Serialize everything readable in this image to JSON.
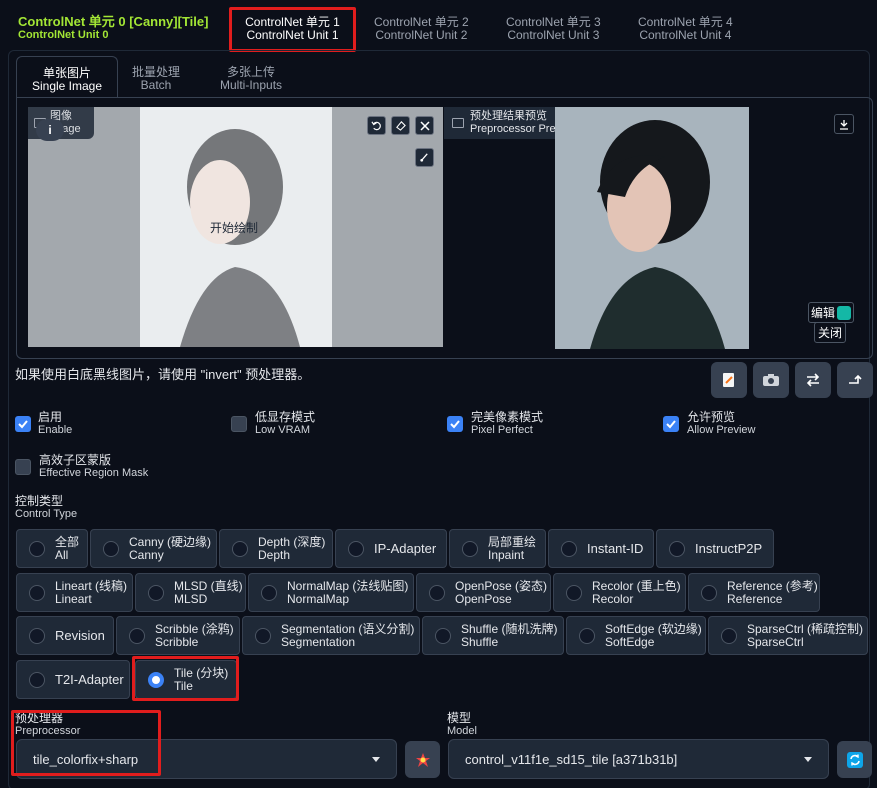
{
  "unit_tabs": [
    {
      "l1": "ControlNet 单元 0 [Canny][Tile]",
      "l2": "ControlNet Unit 0"
    },
    {
      "l1": "ControlNet 单元 1",
      "l2": "ControlNet Unit 1"
    },
    {
      "l1": "ControlNet 单元 2",
      "l2": "ControlNet Unit 2"
    },
    {
      "l1": "ControlNet 单元 3",
      "l2": "ControlNet Unit 3"
    },
    {
      "l1": "ControlNet 单元 4",
      "l2": "ControlNet Unit 4"
    }
  ],
  "input_tabs": [
    {
      "l1": "单张图片",
      "l2": "Single Image"
    },
    {
      "l1": "批量处理",
      "l2": "Batch"
    },
    {
      "l1": "多张上传",
      "l2": "Multi-Inputs"
    }
  ],
  "image_panel": {
    "l1": "图像",
    "l2": "Image",
    "overlay": "开始绘制"
  },
  "preview_panel": {
    "l1": "预处理结果预览",
    "l2": "Preprocessor Preview",
    "edit": "编辑",
    "close": "关闭"
  },
  "hint": "如果使用白底黑线图片，请使用 \"invert\" 预处理器。",
  "options": [
    {
      "l1": "启用",
      "l2": "Enable",
      "checked": true
    },
    {
      "l1": "低显存模式",
      "l2": "Low VRAM",
      "checked": false
    },
    {
      "l1": "完美像素模式",
      "l2": "Pixel Perfect",
      "checked": true
    },
    {
      "l1": "允许预览",
      "l2": "Allow Preview",
      "checked": true
    },
    {
      "l1": "高效子区蒙版",
      "l2": "Effective Region Mask",
      "checked": false
    }
  ],
  "control_type": {
    "l1": "控制类型",
    "l2": "Control Type",
    "items": [
      {
        "l1": "全部",
        "l2": "All"
      },
      {
        "l1": "Canny (硬边缘)",
        "l2": "Canny"
      },
      {
        "l1": "Depth (深度)",
        "l2": "Depth"
      },
      {
        "l1": "IP-Adapter",
        "l2": ""
      },
      {
        "l1": "局部重绘",
        "l2": "Inpaint"
      },
      {
        "l1": "Instant-ID",
        "l2": ""
      },
      {
        "l1": "InstructP2P",
        "l2": ""
      },
      {
        "l1": "Lineart (线稿)",
        "l2": "Lineart"
      },
      {
        "l1": "MLSD (直线)",
        "l2": "MLSD"
      },
      {
        "l1": "NormalMap (法线贴图)",
        "l2": "NormalMap"
      },
      {
        "l1": "OpenPose (姿态)",
        "l2": "OpenPose"
      },
      {
        "l1": "Recolor (重上色)",
        "l2": "Recolor"
      },
      {
        "l1": "Reference (参考)",
        "l2": "Reference"
      },
      {
        "l1": "Revision",
        "l2": ""
      },
      {
        "l1": "Scribble (涂鸦)",
        "l2": "Scribble"
      },
      {
        "l1": "Segmentation (语义分割)",
        "l2": "Segmentation"
      },
      {
        "l1": "Shuffle (随机洗牌)",
        "l2": "Shuffle"
      },
      {
        "l1": "SoftEdge (软边缘)",
        "l2": "SoftEdge"
      },
      {
        "l1": "SparseCtrl (稀疏控制)",
        "l2": "SparseCtrl"
      },
      {
        "l1": "T2I-Adapter",
        "l2": ""
      },
      {
        "l1": "Tile (分块)",
        "l2": "Tile"
      }
    ],
    "selected": "Tile"
  },
  "preprocessor": {
    "l1": "预处理器",
    "l2": "Preprocessor",
    "value": "tile_colorfix+sharp"
  },
  "model": {
    "l1": "模型",
    "l2": "Model",
    "value": "control_v11f1e_sd15_tile [a371b31b]"
  },
  "colors": {
    "accent": "#3b82f6",
    "unit0": "#a3e635",
    "highlight": "#e11d1d"
  }
}
